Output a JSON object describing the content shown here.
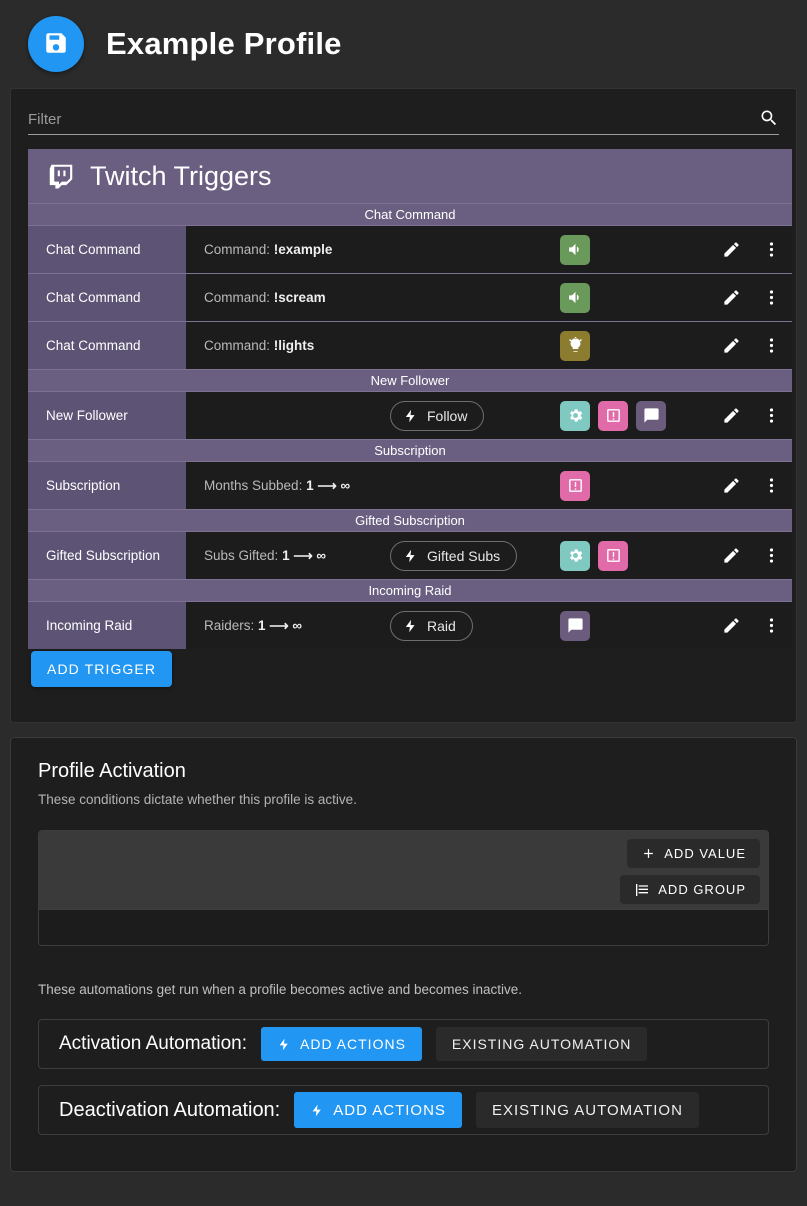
{
  "header": {
    "save_icon": "save-icon",
    "title": "Example Profile"
  },
  "filter": {
    "placeholder": "Filter",
    "value": "",
    "search_icon": "search-icon"
  },
  "triggers_panel": {
    "logo_icon": "twitch-icon",
    "title": "Twitch Triggers",
    "add_trigger_label": "ADD TRIGGER",
    "groups": [
      {
        "category": "Chat Command",
        "rows": [
          {
            "type": "Chat Command",
            "cond_label": "Command:",
            "cond_value": "!example",
            "chip": null,
            "badges": [
              {
                "icon": "volume-icon",
                "color": "#6a9a5b"
              }
            ],
            "edit_icon": "pencil-icon",
            "more_icon": "more-vertical-icon"
          },
          {
            "type": "Chat Command",
            "cond_label": "Command:",
            "cond_value": "!scream",
            "chip": null,
            "badges": [
              {
                "icon": "volume-icon",
                "color": "#6a9a5b"
              }
            ],
            "edit_icon": "pencil-icon",
            "more_icon": "more-vertical-icon"
          },
          {
            "type": "Chat Command",
            "cond_label": "Command:",
            "cond_value": "!lights",
            "chip": null,
            "badges": [
              {
                "icon": "lightbulb-icon",
                "color": "#8c7c30"
              }
            ],
            "edit_icon": "pencil-icon",
            "more_icon": "more-vertical-icon"
          }
        ]
      },
      {
        "category": "New Follower",
        "rows": [
          {
            "type": "New Follower",
            "cond_label": "",
            "cond_value": "",
            "chip": {
              "icon": "bolt-icon",
              "label": "Follow"
            },
            "badges": [
              {
                "icon": "gear-icon",
                "color": "#7fc9c0"
              },
              {
                "icon": "announcement-icon",
                "color": "#e06ba8"
              },
              {
                "icon": "chat-bubble-icon",
                "color": "#6b5b7d"
              }
            ],
            "edit_icon": "pencil-icon",
            "more_icon": "more-vertical-icon"
          }
        ]
      },
      {
        "category": "Subscription",
        "rows": [
          {
            "type": "Subscription",
            "cond_label": "Months Subbed:",
            "cond_value": "1 ⟶ ∞",
            "chip": null,
            "badges": [
              {
                "icon": "announcement-icon",
                "color": "#e06ba8"
              }
            ],
            "edit_icon": "pencil-icon",
            "more_icon": "more-vertical-icon"
          }
        ]
      },
      {
        "category": "Gifted Subscription",
        "rows": [
          {
            "type": "Gifted Subscription",
            "cond_label": "Subs Gifted:",
            "cond_value": "1 ⟶ ∞",
            "chip": {
              "icon": "bolt-icon",
              "label": "Gifted Subs"
            },
            "badges": [
              {
                "icon": "gear-icon",
                "color": "#7fc9c0"
              },
              {
                "icon": "announcement-icon",
                "color": "#e06ba8"
              }
            ],
            "edit_icon": "pencil-icon",
            "more_icon": "more-vertical-icon"
          }
        ]
      },
      {
        "category": "Incoming Raid",
        "rows": [
          {
            "type": "Incoming Raid",
            "cond_label": "Raiders:",
            "cond_value": "1 ⟶ ∞",
            "chip": {
              "icon": "bolt-icon",
              "label": "Raid"
            },
            "badges": [
              {
                "icon": "chat-bubble-icon",
                "color": "#6b5b7d"
              }
            ],
            "edit_icon": "pencil-icon",
            "more_icon": "more-vertical-icon"
          }
        ]
      }
    ]
  },
  "activation": {
    "title": "Profile Activation",
    "subtitle": "These conditions dictate whether this profile is active.",
    "add_value_label": "ADD VALUE",
    "add_value_icon": "plus-icon",
    "add_group_label": "ADD GROUP",
    "add_group_icon": "group-list-icon",
    "automation_note": "These automations get run when a profile becomes active and becomes inactive.",
    "activation_automation": {
      "label": "Activation Automation:",
      "add_actions_label": "ADD ACTIONS",
      "add_actions_icon": "bolt-icon",
      "existing_label": "EXISTING AUTOMATION"
    },
    "deactivation_automation": {
      "label": "Deactivation Automation:",
      "add_actions_label": "ADD ACTIONS",
      "add_actions_icon": "bolt-icon",
      "existing_label": "EXISTING AUTOMATION"
    }
  },
  "colors": {
    "accent_blue": "#2196f3",
    "twitch_purple": "#6a5f80",
    "row_purple": "#5d5375",
    "page_bg": "#2b2b2b"
  }
}
